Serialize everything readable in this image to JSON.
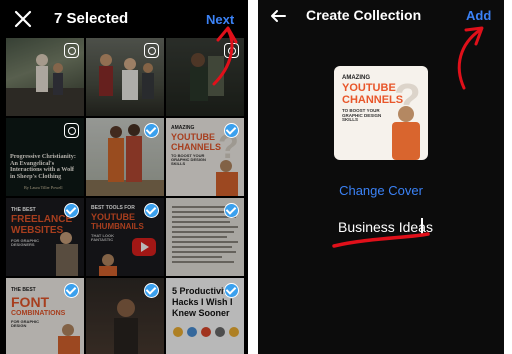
{
  "left_screen": {
    "title": "7 Selected",
    "next_label": "Next",
    "tiles": [
      {
        "state": "reel"
      },
      {
        "state": "reel"
      },
      {
        "state": "reel"
      },
      {
        "state": "reel",
        "title": "Progressive Christianity: An Evangelical's Interactions with a Wolf in Sheep's Clothing",
        "byline": "By Laura Tiller Powell"
      },
      {
        "state": "selected"
      },
      {
        "state": "selected",
        "l1": "AMAZING",
        "l2": "YOUTUBE",
        "l3": "CHANNELS",
        "l4": "TO BOOST YOUR GRAPHIC DESIGN SKILLS"
      },
      {
        "state": "selected",
        "l1": "THE BEST",
        "l2": "FREELANCE",
        "l3": "WEBSITES",
        "l4": "FOR GRAPHIC DESIGNERS"
      },
      {
        "state": "selected",
        "l1": "BEST TOOLS FOR",
        "l2": "YOUTUBE",
        "l3": "THUMBNAILS",
        "l4": "THAT LOOK FANTASTIC"
      },
      {
        "state": "selected"
      },
      {
        "state": "selected",
        "l1": "THE BEST",
        "l2": "FONT",
        "l3": "COMBINATIONS",
        "l4": "FOR GRAPHIC DESIGN"
      },
      {
        "state": "selected"
      },
      {
        "state": "selected",
        "l1": "5 Productivity",
        "l2": "Hacks I Wish I",
        "l3": "Knew Sooner"
      }
    ]
  },
  "right_screen": {
    "title": "Create Collection",
    "add_label": "Add",
    "cover": {
      "l1": "AMAZING",
      "l2": "YOUTUBE",
      "l3": "CHANNELS",
      "l4": "TO BOOST YOUR GRAPHIC DESIGN SKILLS"
    },
    "change_cover_label": "Change Cover",
    "collection_name": "Business Ideas"
  },
  "colors": {
    "accent": "#3b82f6",
    "annotation": "#e0101a",
    "badge": "#3aa0ee",
    "brand_orange": "#e8562a"
  }
}
